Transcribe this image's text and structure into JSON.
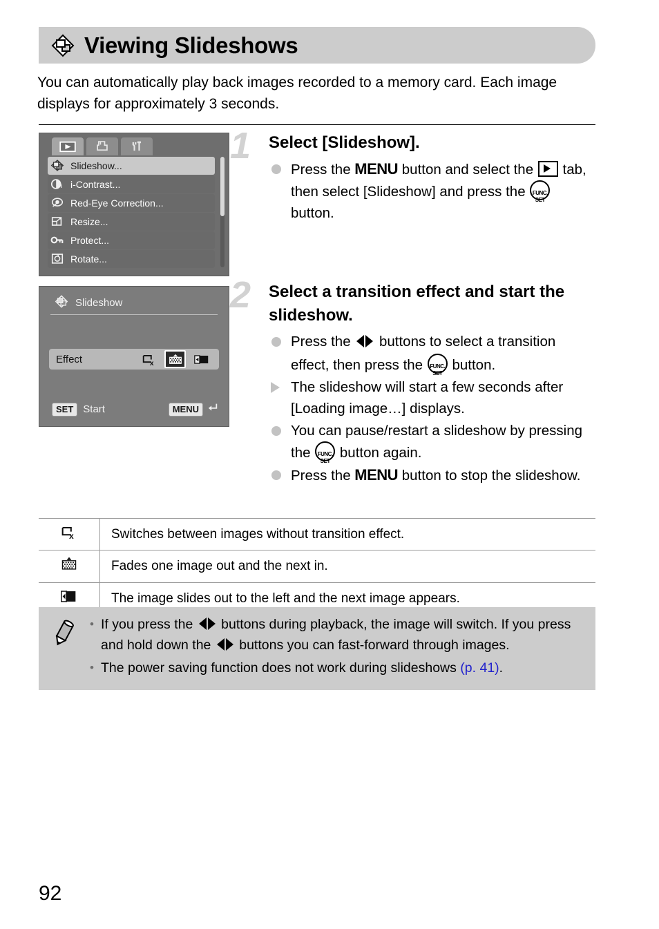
{
  "header": {
    "icon": "slideshow-icon",
    "title": "Viewing Slideshows"
  },
  "intro": "You can automatically play back images recorded to a memory card. Each image displays for approximately 3 seconds.",
  "lcd_menu": {
    "tabs": [
      {
        "icon": "playback-tab-icon",
        "active": true
      },
      {
        "icon": "print-tab-icon",
        "active": false
      },
      {
        "icon": "settings-tab-icon",
        "active": false
      }
    ],
    "items": [
      {
        "icon": "slideshow-icon",
        "label": "Slideshow...",
        "selected": true
      },
      {
        "icon": "i-contrast-icon",
        "label": "i-Contrast...",
        "selected": false
      },
      {
        "icon": "red-eye-icon",
        "label": "Red-Eye Correction...",
        "selected": false
      },
      {
        "icon": "resize-icon",
        "label": "Resize...",
        "selected": false
      },
      {
        "icon": "protect-key-icon",
        "label": "Protect...",
        "selected": false
      },
      {
        "icon": "rotate-icon",
        "label": "Rotate...",
        "selected": false
      }
    ]
  },
  "lcd_slideshow": {
    "title": "Slideshow",
    "title_icon": "slideshow-icon",
    "effect_label": "Effect",
    "effects": [
      {
        "icon": "no-effect-icon",
        "selected": false
      },
      {
        "icon": "fade-effect-icon",
        "selected": true
      },
      {
        "icon": "slide-effect-icon",
        "selected": false
      }
    ],
    "set_badge": "SET",
    "start_label": "Start",
    "menu_badge": "MENU",
    "back_icon": "return-arrow-icon"
  },
  "step1": {
    "number": "1",
    "heading": "Select [Slideshow].",
    "bullets": [
      {
        "marker": "dot",
        "parts": [
          {
            "t": "text",
            "v": "Press the "
          },
          {
            "t": "menu"
          },
          {
            "t": "text",
            "v": " button and select the "
          },
          {
            "t": "playtab"
          },
          {
            "t": "text",
            "v": " tab, then select [Slideshow] and press the "
          },
          {
            "t": "funcset"
          },
          {
            "t": "text",
            "v": " button."
          }
        ]
      }
    ]
  },
  "step2": {
    "number": "2",
    "heading": "Select a transition effect and start the slideshow.",
    "bullets": [
      {
        "marker": "dot",
        "parts": [
          {
            "t": "text",
            "v": "Press the "
          },
          {
            "t": "lr"
          },
          {
            "t": "text",
            "v": " buttons to select a transition effect, then press the "
          },
          {
            "t": "funcset"
          },
          {
            "t": "text",
            "v": " button."
          }
        ]
      },
      {
        "marker": "triangle",
        "parts": [
          {
            "t": "text",
            "v": "The slideshow will start a few seconds after [Loading image…] displays."
          }
        ]
      },
      {
        "marker": "dot",
        "parts": [
          {
            "t": "text",
            "v": "You can pause/restart a slideshow by pressing the "
          },
          {
            "t": "funcset"
          },
          {
            "t": "text",
            "v": " button again."
          }
        ]
      },
      {
        "marker": "dot",
        "parts": [
          {
            "t": "text",
            "v": "Press the "
          },
          {
            "t": "menu"
          },
          {
            "t": "text",
            "v": " button to stop the slideshow."
          }
        ]
      }
    ]
  },
  "effects_table": {
    "rows": [
      {
        "icon": "no-effect-icon",
        "description": "Switches between images without transition effect."
      },
      {
        "icon": "fade-effect-icon",
        "description": "Fades one image out and the next in."
      },
      {
        "icon": "slide-effect-icon",
        "description": "The image slides out to the left and the next image appears."
      }
    ]
  },
  "note": {
    "icon": "pencil-note-icon",
    "items": [
      {
        "parts": [
          {
            "t": "text",
            "v": "If you press the "
          },
          {
            "t": "lr"
          },
          {
            "t": "text",
            "v": " buttons during playback, the image will switch. If you press and hold down the "
          },
          {
            "t": "lr"
          },
          {
            "t": "text",
            "v": " buttons you can fast-forward through images."
          }
        ]
      },
      {
        "parts": [
          {
            "t": "text",
            "v": "The power saving function does not work during slideshows "
          },
          {
            "t": "link",
            "v": "(p. 41)"
          },
          {
            "t": "text",
            "v": "."
          }
        ]
      }
    ]
  },
  "page_number": "92",
  "colors": {
    "header_bg": "#cccccc",
    "note_bg": "#cccccc",
    "link": "#2222cc",
    "step_number": "#d2d2d2",
    "bullet_marker": "#c2c2c2"
  }
}
